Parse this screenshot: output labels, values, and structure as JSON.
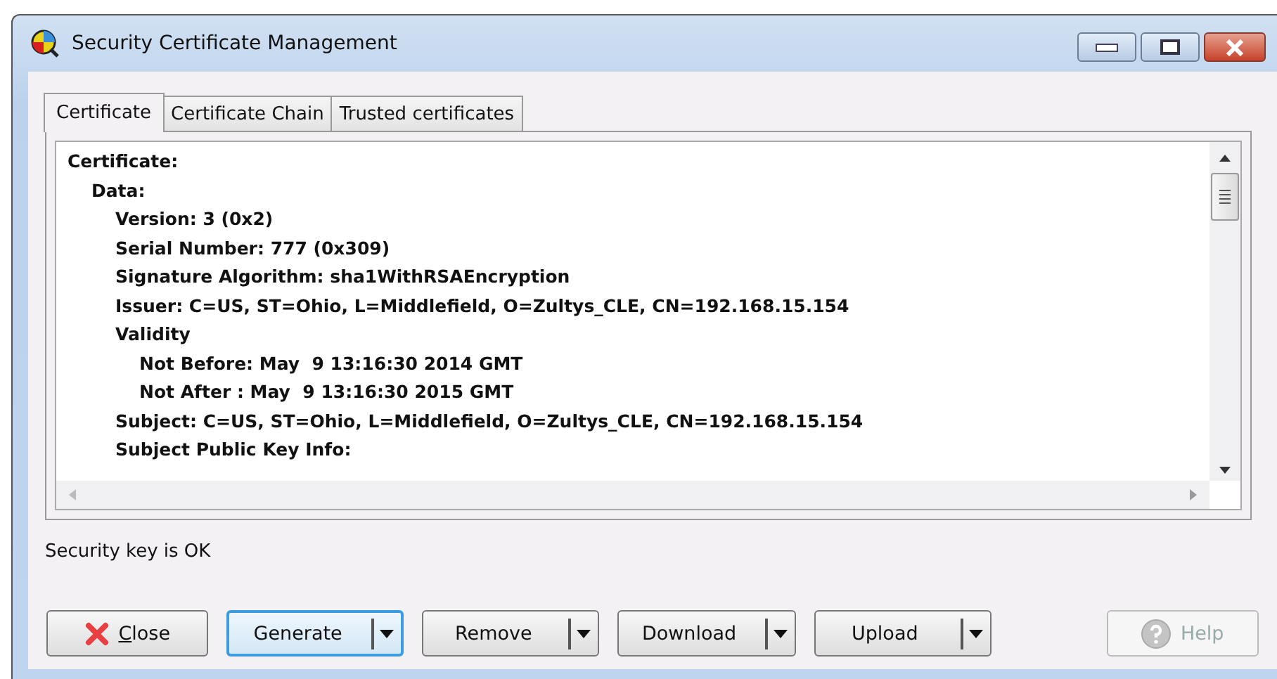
{
  "window": {
    "title": "Security Certificate Management"
  },
  "tabs": [
    {
      "label": "Certificate",
      "selected": true
    },
    {
      "label": "Certificate Chain",
      "selected": false
    },
    {
      "label": "Trusted certificates",
      "selected": false
    }
  ],
  "certificate_text": [
    {
      "text": "Certificate:",
      "children": [
        {
          "text": "Data:",
          "children": [
            {
              "text": "Version: 3 (0x2)"
            },
            {
              "text": "Serial Number: 777 (0x309)"
            },
            {
              "text": "Signature Algorithm: sha1WithRSAEncryption"
            },
            {
              "text": "Issuer: C=US, ST=Ohio, L=Middlefield, O=Zultys_CLE, CN=192.168.15.154"
            },
            {
              "text": "Validity",
              "children": [
                {
                  "text": "Not Before: May  9 13:16:30 2014 GMT"
                },
                {
                  "text": "Not After : May  9 13:16:30 2015 GMT"
                }
              ]
            },
            {
              "text": "Subject: C=US, ST=Ohio, L=Middlefield, O=Zultys_CLE, CN=192.168.15.154"
            },
            {
              "text": "Subject Public Key Info:"
            }
          ]
        }
      ]
    }
  ],
  "status": "Security key is OK",
  "buttons": [
    {
      "label": "Close",
      "kind": "close",
      "mnemonic_underlined": true,
      "focused": false,
      "disabled": false
    },
    {
      "label": "Generate",
      "kind": "split",
      "focused": true,
      "disabled": false
    },
    {
      "label": "Remove",
      "kind": "split",
      "focused": false,
      "disabled": false
    },
    {
      "label": "Download",
      "kind": "split",
      "focused": false,
      "disabled": false
    },
    {
      "label": "Upload",
      "kind": "split",
      "focused": false,
      "disabled": false
    },
    {
      "label": "Help",
      "kind": "help",
      "focused": false,
      "disabled": true
    }
  ]
}
